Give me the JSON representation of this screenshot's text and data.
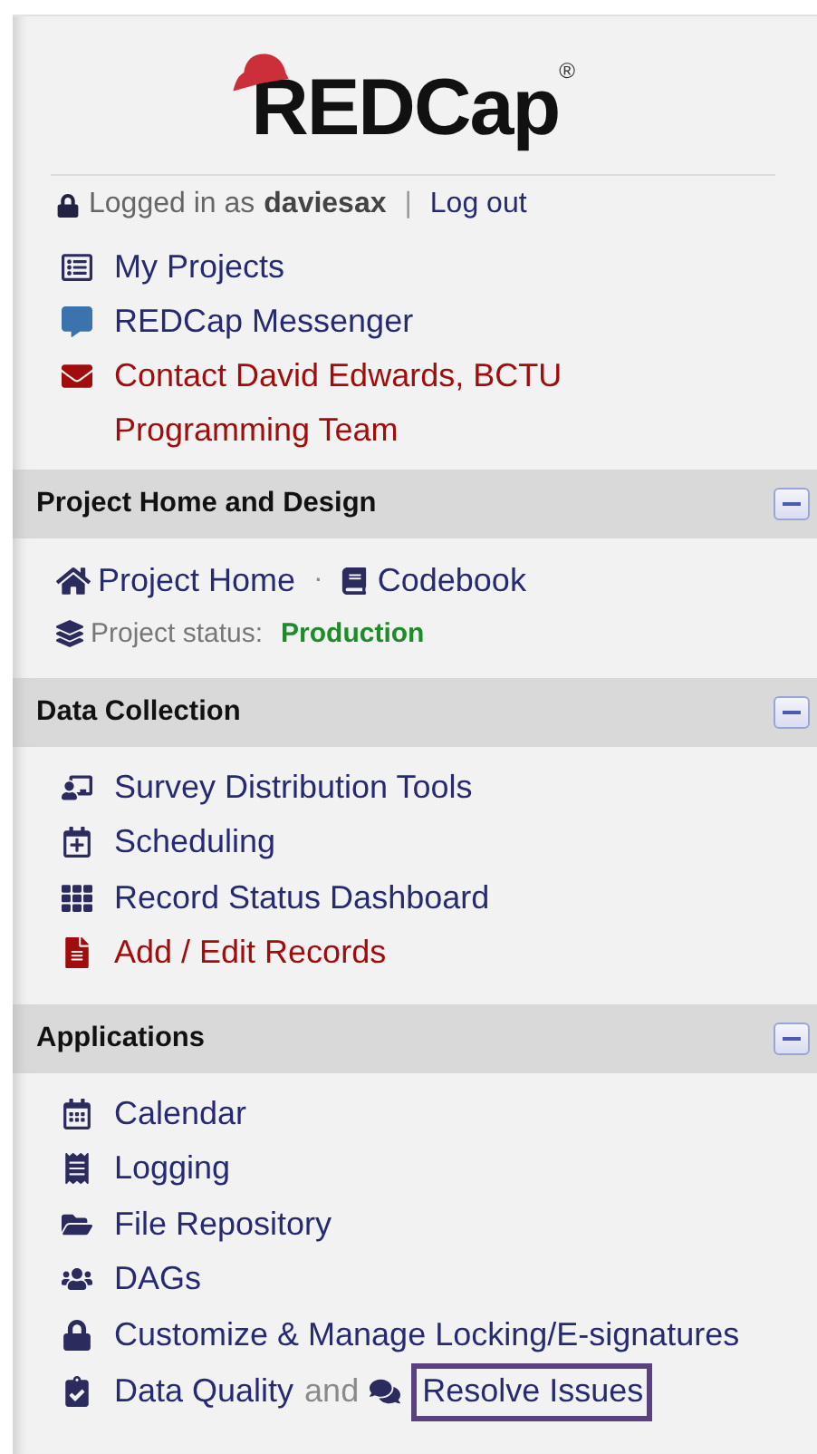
{
  "logo": {
    "text": "REDCap",
    "mark": "®"
  },
  "login": {
    "prefix": "Logged in as",
    "user": "daviesax",
    "separator": "|",
    "logout": "Log out"
  },
  "links": [
    {
      "kind": "link",
      "label": "My Projects"
    },
    {
      "kind": "link",
      "label": "REDCap Messenger"
    },
    {
      "kind": "danger",
      "label": "Contact David Edwards, BCTU Programming Team"
    }
  ],
  "sections": [
    {
      "kind": "home",
      "title": "Project Home and Design",
      "expanded": true,
      "links": [
        {
          "label": "Project Home"
        },
        {
          "label": "Codebook"
        }
      ],
      "separator": "·",
      "status": {
        "label": "Project status:",
        "value": "Production"
      }
    },
    {
      "kind": "list",
      "title": "Data Collection",
      "expanded": true,
      "items": [
        {
          "kind": "link",
          "label": "Survey Distribution Tools"
        },
        {
          "kind": "link",
          "label": "Scheduling"
        },
        {
          "kind": "link",
          "label": "Record Status Dashboard"
        },
        {
          "kind": "danger",
          "label": "Add / Edit Records"
        }
      ]
    },
    {
      "kind": "list",
      "title": "Applications",
      "expanded": true,
      "items": [
        {
          "kind": "link",
          "label": "Calendar"
        },
        {
          "kind": "link",
          "label": "Logging"
        },
        {
          "kind": "link",
          "label": "File Repository"
        },
        {
          "kind": "link",
          "label": "DAGs"
        },
        {
          "kind": "link",
          "label": "Customize & Manage Locking/E-signatures"
        },
        {
          "kind": "combo",
          "label": "Data Quality",
          "joiner": "and",
          "second": "Resolve Issues",
          "highlighted": true
        }
      ]
    }
  ]
}
